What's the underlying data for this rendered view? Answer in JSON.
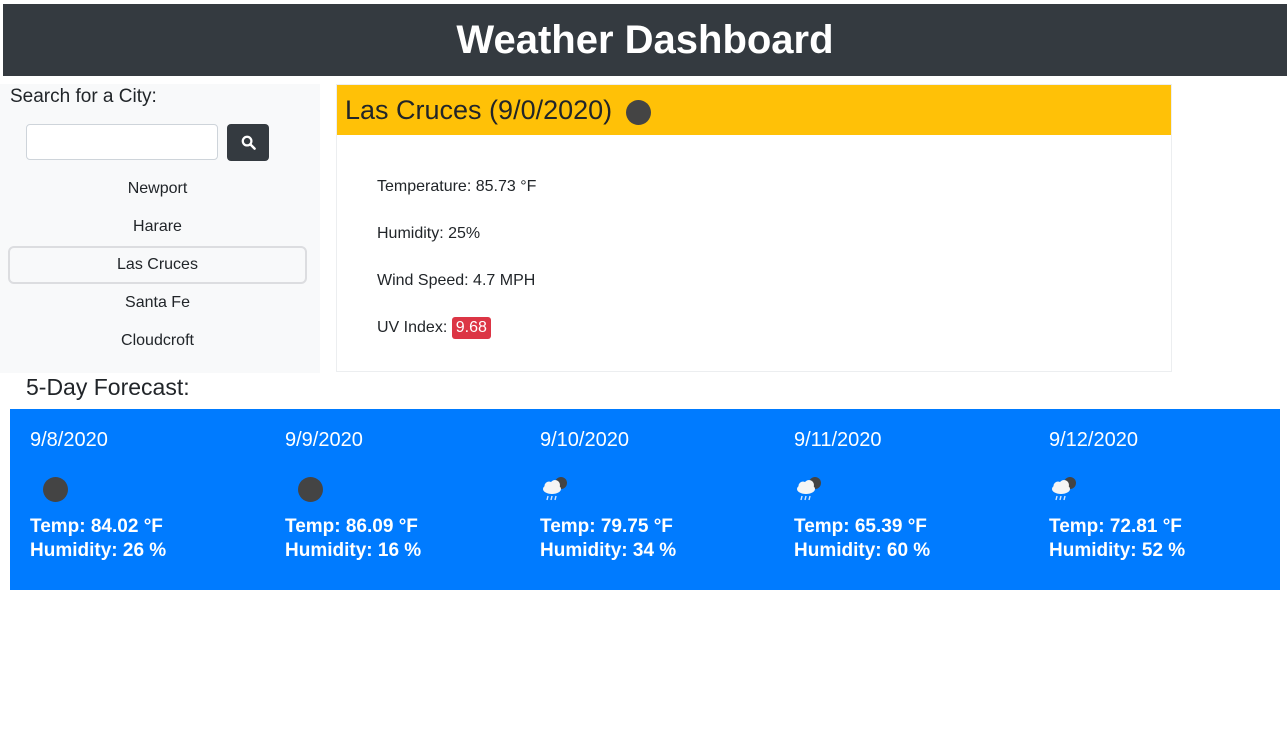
{
  "header": {
    "title": "Weather Dashboard"
  },
  "sidebar": {
    "title": "Search for a City:",
    "search": {
      "value": "",
      "placeholder": ""
    },
    "search_button_icon": "search-icon",
    "cities": [
      "Newport",
      "Harare",
      "Las Cruces",
      "Santa Fe",
      "Cloudcroft"
    ],
    "active_city": "Las Cruces"
  },
  "current": {
    "title": "Las Cruces (9/0/2020)",
    "icon": "clear-night-icon",
    "temperature": "Temperature: 85.73 °F",
    "humidity": "Humidity: 25%",
    "wind": "Wind Speed: 4.7 MPH",
    "uv_label": "UV Index:",
    "uv_value": "9.68",
    "uv_color": "#dc3545",
    "header_color": "#ffc107"
  },
  "forecast": {
    "title": "5-Day Forecast:",
    "color": "#007bff",
    "days": [
      {
        "date": "9/8/2020",
        "icon": "clear-night-icon",
        "temp": "Temp: 84.02 °F",
        "humidity": "Humidity: 26 %"
      },
      {
        "date": "9/9/2020",
        "icon": "clear-night-icon",
        "temp": "Temp: 86.09 °F",
        "humidity": "Humidity: 16 %"
      },
      {
        "date": "9/10/2020",
        "icon": "rain-night-icon",
        "temp": "Temp: 79.75 °F",
        "humidity": "Humidity: 34 %"
      },
      {
        "date": "9/11/2020",
        "icon": "rain-night-icon",
        "temp": "Temp: 65.39 °F",
        "humidity": "Humidity: 60 %"
      },
      {
        "date": "9/12/2020",
        "icon": "rain-night-icon",
        "temp": "Temp: 72.81 °F",
        "humidity": "Humidity: 52 %"
      }
    ]
  }
}
